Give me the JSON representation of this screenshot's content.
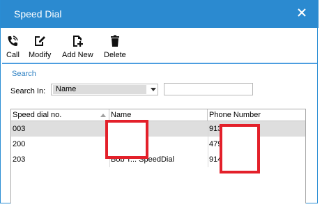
{
  "window": {
    "title": "Speed Dial"
  },
  "toolbar": {
    "call_label": "Call",
    "modify_label": "Modify",
    "add_new_label": "Add New",
    "delete_label": "Delete"
  },
  "search": {
    "section_label": "Search",
    "search_in_label": "Search In:",
    "field_value": "Name",
    "query": ""
  },
  "table": {
    "headers": [
      "Speed dial no.",
      "Name",
      "Phone Number"
    ],
    "rows": [
      {
        "speed_dial_no": "003",
        "name": "",
        "phone": "913"
      },
      {
        "speed_dial_no": "200",
        "name": "",
        "phone": "479"
      },
      {
        "speed_dial_no": "203",
        "name": "Bob T... SpeedDial",
        "phone": "914"
      }
    ]
  },
  "colors": {
    "title_bar": "#2b8ad0",
    "accent": "#2b7fc2",
    "redaction": "#e3202a"
  }
}
